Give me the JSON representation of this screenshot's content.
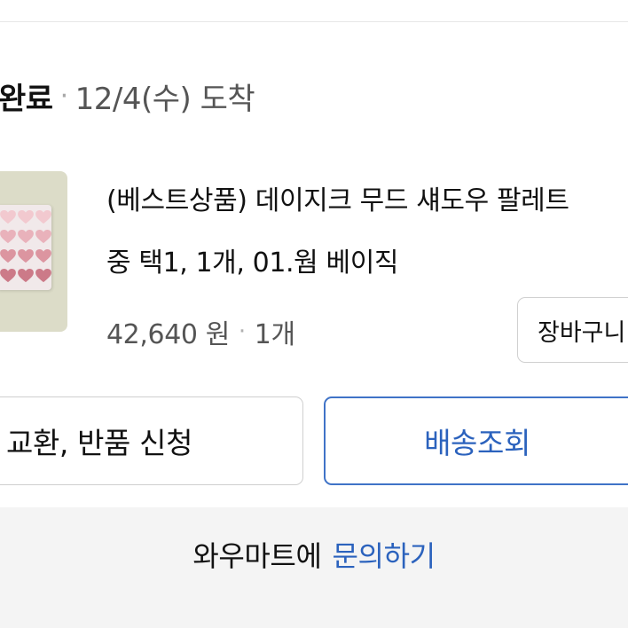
{
  "order": {
    "status_done": "완료",
    "arrival_text": "12/4(수) 도착"
  },
  "product": {
    "name": "(베스트상품) 데이지크 무드 섀도우 팔레트",
    "option": "중 택1, 1개, 01.웜 베이직",
    "price": "42,640 원",
    "quantity": "1개",
    "cart_button_label": "장바구니",
    "thumbnail_icon": "eyeshadow-palette-image"
  },
  "actions": {
    "exchange_label": "교환, 반품 신청",
    "track_label": "배송조회"
  },
  "contact": {
    "prefix": "와우마트에",
    "link_label": "문의하기"
  },
  "colors": {
    "link_blue": "#2b62bd",
    "track_border": "#3f73c7"
  }
}
